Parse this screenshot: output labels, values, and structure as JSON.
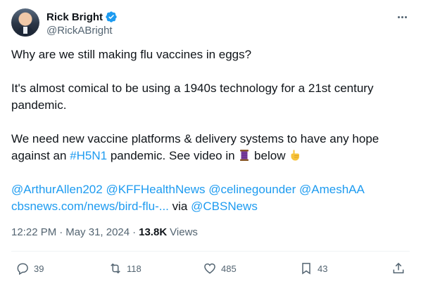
{
  "author": {
    "display_name": "Rick Bright",
    "handle": "@RickABright",
    "verified_color": "#1d9bf0"
  },
  "tweet": {
    "line1": "Why are we still making flu vaccines in eggs?",
    "line2": "It's almost comical to be using a 1940s technology for a 21st century pandemic.",
    "line3_a": "We need new vaccine platforms & delivery systems to have any hope against an",
    "hashtag": "#H5N1",
    "line3_b": "pandemic. See video in",
    "line3_c": "below",
    "emoji_thread": "thread-spool-emoji",
    "emoji_point": "pointing-down-emoji",
    "mentions": [
      "@ArthurAllen202",
      "@KFFHealthNews",
      "@celinegounder",
      "@AmeshAA"
    ],
    "link_text": "cbsnews.com/news/bird-flu-...",
    "via_word": "via",
    "via_handle": "@CBSNews"
  },
  "meta": {
    "time": "12:22 PM",
    "separator": "·",
    "date": "May 31, 2024",
    "views_count": "13.8K",
    "views_label": "Views"
  },
  "actions": {
    "reply_count": "39",
    "retweet_count": "118",
    "like_count": "485",
    "bookmark_count": "43"
  },
  "colors": {
    "text": "#0f1419",
    "secondary": "#536471",
    "link": "#1d9bf0",
    "divider": "#eff3f4"
  }
}
